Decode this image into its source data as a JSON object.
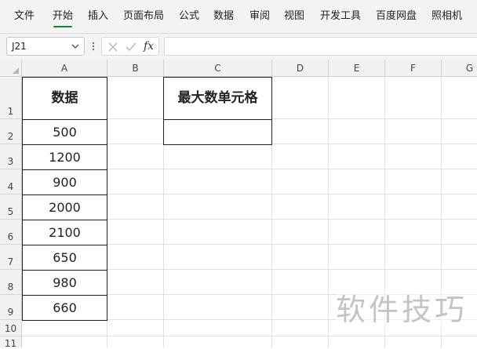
{
  "menu": {
    "items": [
      "文件",
      "开始",
      "插入",
      "页面布局",
      "公式",
      "数据",
      "审阅",
      "视图",
      "开发工具",
      "百度网盘",
      "照相机"
    ],
    "active_index": 1
  },
  "formula_bar": {
    "name_box_value": "J21",
    "fx_label": "fx",
    "formula_value": ""
  },
  "sheet": {
    "columns": [
      "A",
      "B",
      "C",
      "D",
      "E",
      "F",
      "G"
    ],
    "rows": [
      "1",
      "2",
      "3",
      "4",
      "5",
      "6",
      "7",
      "8",
      "9",
      "10",
      "11"
    ],
    "cells": {
      "A1": "数据",
      "A2": "500",
      "A3": "1200",
      "A4": "900",
      "A5": "2000",
      "A6": "2100",
      "A7": "650",
      "A8": "980",
      "A9": "660",
      "C1": "最大数单元格",
      "C2": ""
    }
  },
  "watermark": "软件技巧",
  "colors": {
    "accent": "#1f7a42",
    "chrome_bg": "#f3f3f3",
    "header_bg": "#f1f1f1",
    "gridline": "#e0e0e0"
  }
}
